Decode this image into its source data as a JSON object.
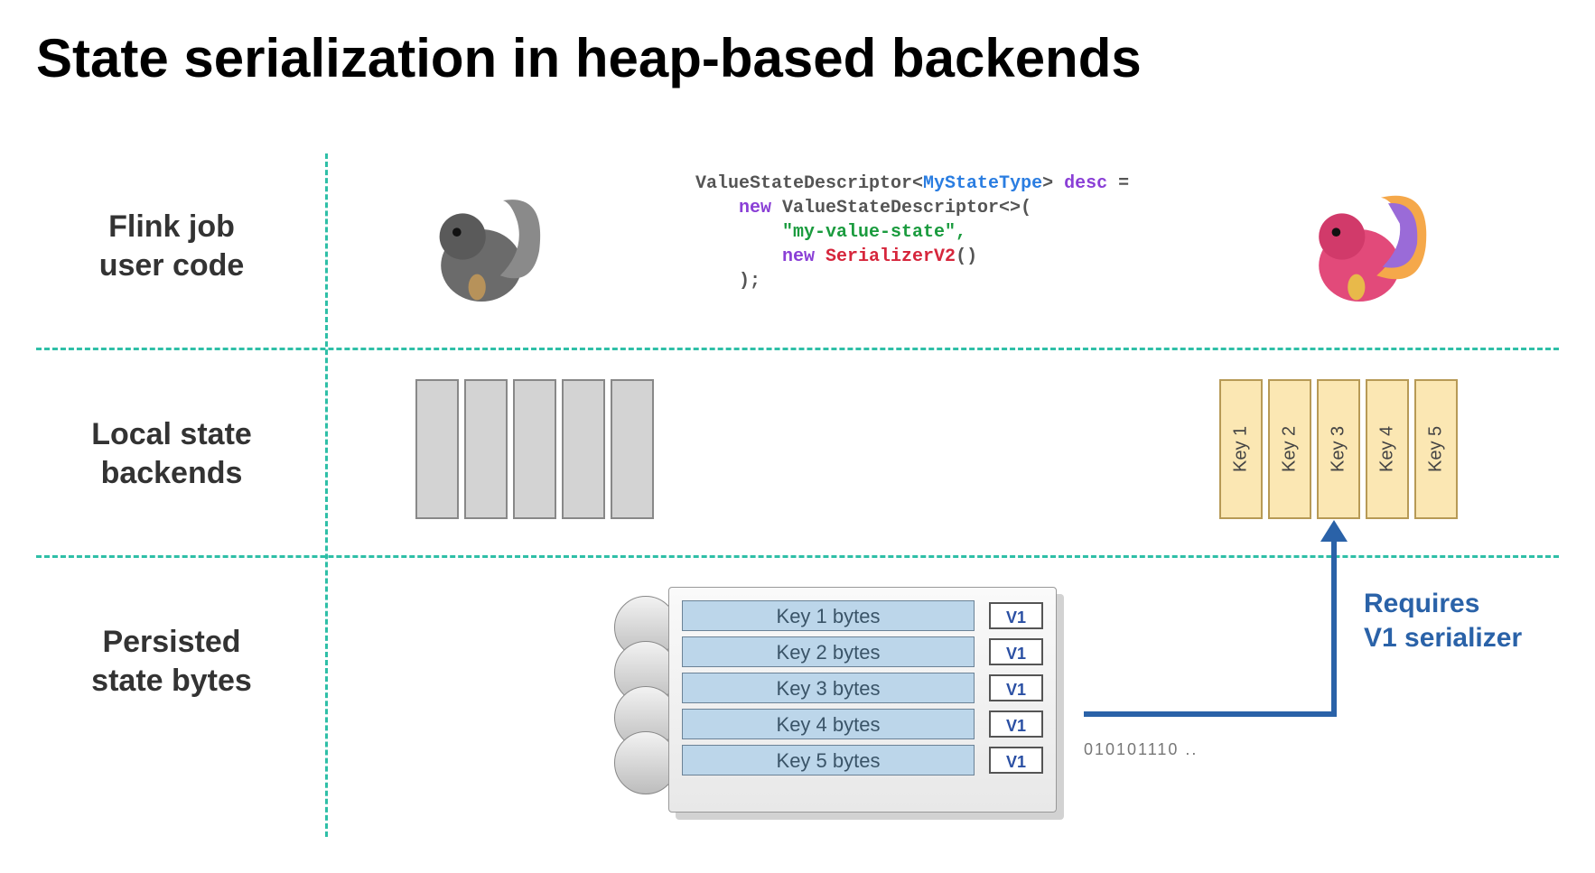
{
  "title": "State serialization in heap-based backends",
  "rows": {
    "r1": "Flink job\nuser code",
    "r2": "Local state\nbackends",
    "r3": "Persisted\nstate bytes"
  },
  "code": {
    "line1a": "ValueStateDescriptor<",
    "line1b": "MyStateType",
    "line1c": "> ",
    "line1d": "desc",
    "line1e": " =",
    "line2a": "    new",
    "line2b": " ValueStateDescriptor<>( ",
    "line3": "        \"my-value-state\",",
    "line4a": "        new",
    "line4b": " SerializerV2",
    "line4c": "()",
    "line5": "    );"
  },
  "keysB": [
    "Key 1",
    "Key 2",
    "Key 3",
    "Key 4",
    "Key 5"
  ],
  "db": {
    "rows": [
      {
        "k": "Key 1 bytes",
        "v": "V1"
      },
      {
        "k": "Key 2 bytes",
        "v": "V1"
      },
      {
        "k": "Key 3 bytes",
        "v": "V1"
      },
      {
        "k": "Key 4 bytes",
        "v": "V1"
      },
      {
        "k": "Key 5 bytes",
        "v": "V1"
      }
    ]
  },
  "arrow_label": "Requires\nV1 serializer",
  "bits": "010101110 .."
}
